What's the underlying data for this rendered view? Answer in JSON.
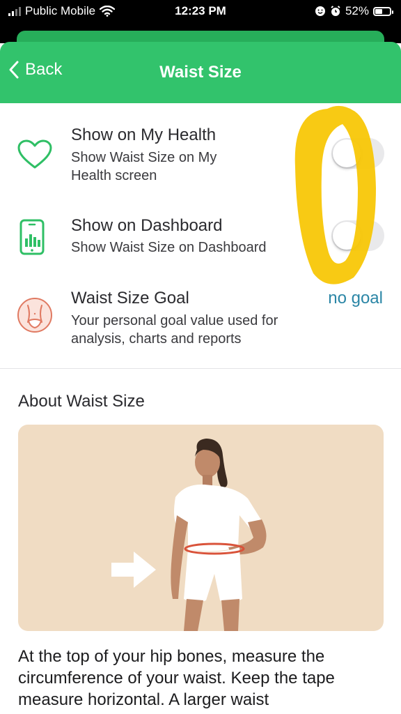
{
  "status_bar": {
    "carrier": "Public Mobile",
    "time": "12:23 PM",
    "battery": "52%",
    "battery_level": 0.52
  },
  "nav": {
    "back_label": "Back",
    "title": "Waist Size"
  },
  "rows": [
    {
      "title": "Show on My Health",
      "description_line1": "Show Waist Size on My",
      "description_line2": "Health screen",
      "icon": "heart-icon",
      "toggle_on": false
    },
    {
      "title": "Show on Dashboard",
      "description_line1": "Show Waist Size on Dashboard",
      "icon": "dashboard-chart-icon",
      "toggle_on": false
    },
    {
      "title": "Waist Size Goal",
      "description_line1": "Your personal goal value used for",
      "description_line2": "analysis, charts and reports",
      "icon": "waist-icon",
      "value": "no goal"
    }
  ],
  "about": {
    "title": "About Waist Size",
    "text": "At the top of your hip bones, measure the circumference of your waist. Keep the tape measure horizontal. A larger waist"
  },
  "colors": {
    "accent_green": "#32c36c",
    "link_blue": "#2b86a6",
    "illustration_bg": "#f0dcc3",
    "highlighter": "#f7c600"
  }
}
